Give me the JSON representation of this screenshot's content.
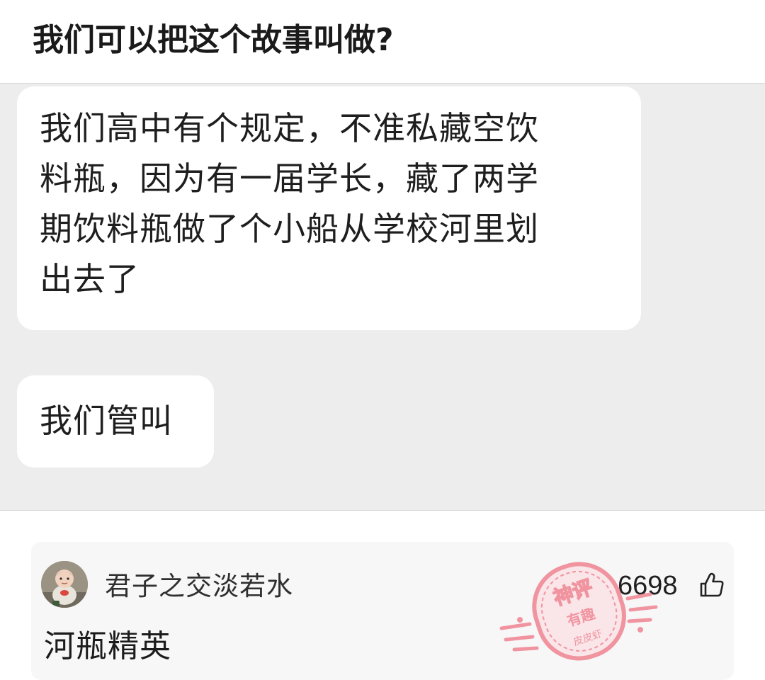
{
  "post": {
    "title": "我们可以把这个故事叫做?"
  },
  "chat": {
    "messages": [
      {
        "lines": [
          "我们高中有个规定，不准私藏空饮",
          "料瓶，因为有一届学长，藏了两学",
          "期饮料瓶做了个小船从学校河里划",
          "出去了"
        ]
      },
      {
        "lines": [
          "我们管叫"
        ]
      }
    ]
  },
  "comment": {
    "username": "君子之交淡若水",
    "text": "河瓶精英",
    "likes": "6698",
    "avatar_icon": "baby-photo-avatar",
    "like_icon": "thumbs-up-icon"
  },
  "stamp": {
    "icon": "hot-comment-stamp",
    "line1": "神评",
    "line2": "有趣",
    "line3": "皮皮虾",
    "color": "#f08a97"
  }
}
